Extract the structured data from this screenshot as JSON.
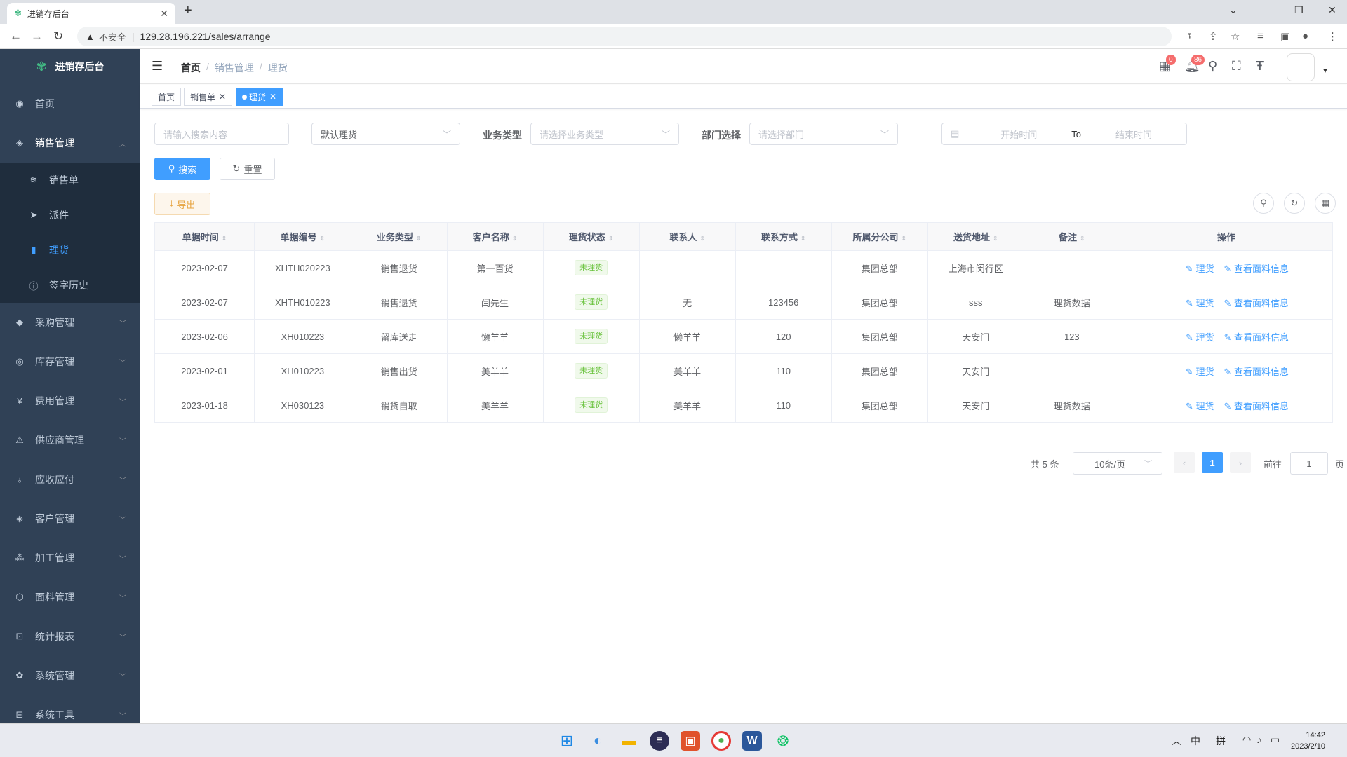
{
  "browser": {
    "tab_title": "进销存后台",
    "insecure_label": "不安全",
    "url": "129.28.196.221/sales/arrange"
  },
  "sidebar": {
    "logo_text": "进销存后台",
    "home": "首页",
    "sales": {
      "label": "销售管理",
      "items": [
        {
          "label": "销售单"
        },
        {
          "label": "派件"
        },
        {
          "label": "理货"
        },
        {
          "label": "签字历史"
        }
      ]
    },
    "menus": [
      {
        "label": "采购管理"
      },
      {
        "label": "库存管理"
      },
      {
        "label": "费用管理"
      },
      {
        "label": "供应商管理"
      },
      {
        "label": "应收应付"
      },
      {
        "label": "客户管理"
      },
      {
        "label": "加工管理"
      },
      {
        "label": "面料管理"
      },
      {
        "label": "统计报表"
      },
      {
        "label": "系统管理"
      },
      {
        "label": "系统工具"
      }
    ]
  },
  "header": {
    "breadcrumb": [
      "首页",
      "销售管理",
      "理货"
    ],
    "badge_calendar": "0",
    "badge_bell": "86"
  },
  "tags": [
    "首页",
    "销售单",
    "理货"
  ],
  "filters": {
    "search_placeholder": "请输入搜索内容",
    "status_value": "默认理货",
    "biz_type_label": "业务类型",
    "biz_type_placeholder": "请选择业务类型",
    "dept_label": "部门选择",
    "dept_placeholder": "请选择部门",
    "start_placeholder": "开始时间",
    "range_sep": "To",
    "end_placeholder": "结束时间",
    "search_btn": "搜索",
    "reset_btn": "重置",
    "export_btn": "导出"
  },
  "table": {
    "columns": [
      "单据时间",
      "单据编号",
      "业务类型",
      "客户名称",
      "理货状态",
      "联系人",
      "联系方式",
      "所属分公司",
      "送货地址",
      "备注",
      "操作"
    ],
    "rows": [
      [
        "2023-02-07",
        "XHTH020223",
        "销售退货",
        "第一百货",
        "未理货",
        "",
        "",
        "集团总部",
        "上海市闵行区",
        ""
      ],
      [
        "2023-02-07",
        "XHTH010223",
        "销售退货",
        "闫先生",
        "未理货",
        "无",
        "123456",
        "集团总部",
        "sss",
        "理货数据"
      ],
      [
        "2023-02-06",
        "XH010223",
        "留库送走",
        "懒羊羊",
        "未理货",
        "懒羊羊",
        "120",
        "集团总部",
        "天安门",
        "123"
      ],
      [
        "2023-02-01",
        "XH010223",
        "销售出货",
        "美羊羊",
        "未理货",
        "美羊羊",
        "110",
        "集团总部",
        "天安门",
        ""
      ],
      [
        "2023-01-18",
        "XH030123",
        "销货自取",
        "美羊羊",
        "未理货",
        "美羊羊",
        "110",
        "集团总部",
        "天安门",
        "理货数据"
      ]
    ],
    "op1": "理货",
    "op2": "查看面料信息"
  },
  "pagination": {
    "total": "共 5 条",
    "page_size": "10条/页",
    "current": "1",
    "goto_label": "前往",
    "goto_value": "1",
    "page_unit": "页"
  },
  "taskbar": {
    "ime1": "中",
    "ime2": "拼",
    "time": "14:42",
    "date": "2023/2/10"
  },
  "colors": {
    "sidebar_bg": "#304156",
    "primary": "#409eff",
    "success": "#67c23a",
    "warning": "#e6a23c"
  }
}
